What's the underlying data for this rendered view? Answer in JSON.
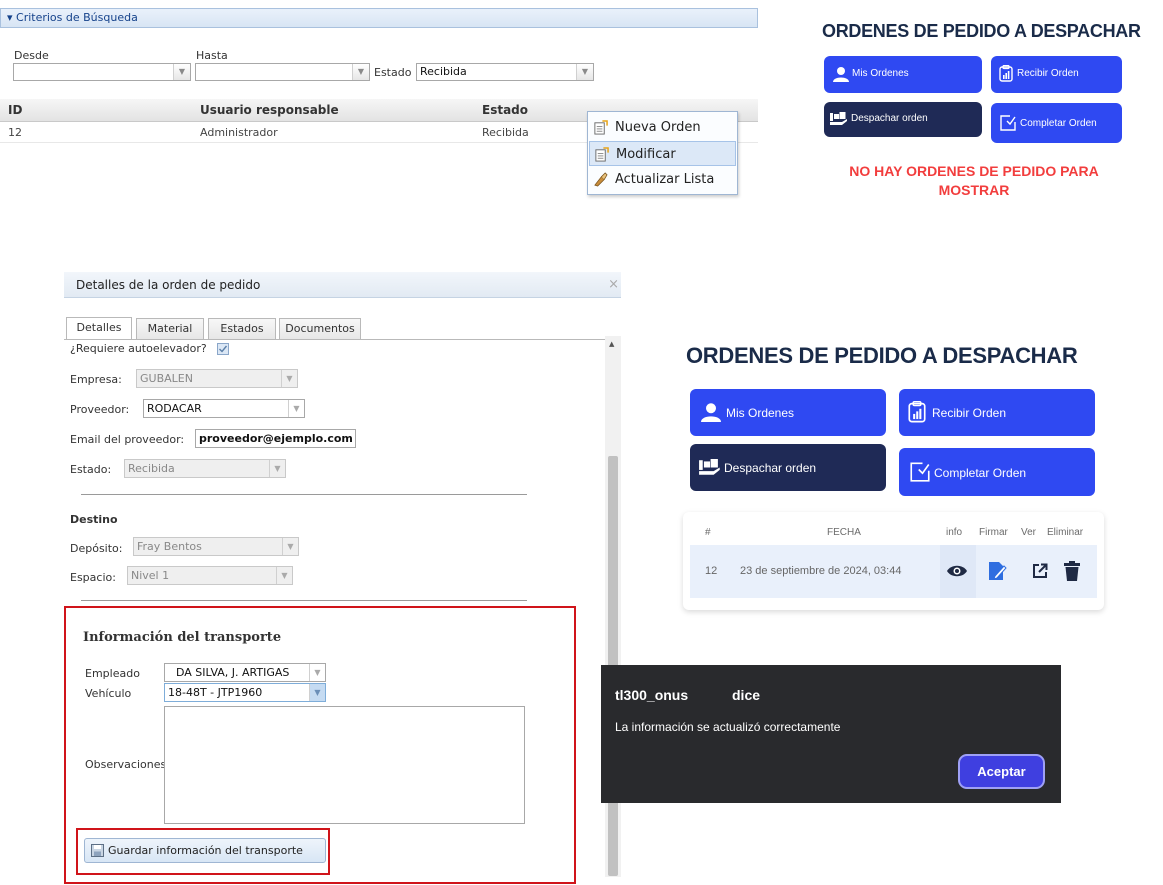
{
  "search_panel": {
    "header": "▾ Criterios de Búsqueda",
    "desde_label": "Desde",
    "hasta_label": "Hasta",
    "estado_label": "Estado",
    "estado_value": "Recibida",
    "columns": [
      "ID",
      "Usuario responsable",
      "Estado"
    ],
    "rows": [
      {
        "id": "12",
        "usuario": "Administrador",
        "estado": "Recibida"
      }
    ],
    "context_menu": [
      {
        "label": "Nueva Orden",
        "icon": "new-order-icon"
      },
      {
        "label": "Modificar",
        "icon": "edit-order-icon"
      },
      {
        "label": "Actualizar Lista",
        "icon": "refresh-icon"
      }
    ]
  },
  "dispatch_small": {
    "title": "ORDENES DE PEDIDO A DESPACHAR",
    "buttons": {
      "mis_ordenes": "Mis Ordenes",
      "recibir_orden": "Recibir Orden",
      "despachar_orden": "Despachar orden",
      "completar_orden": "Completar Orden"
    },
    "empty_message": "NO HAY ORDENES DE PEDIDO PARA MOSTRAR"
  },
  "details_window": {
    "title": "Detalles de la orden de pedido",
    "close": "×",
    "tabs": [
      "Detalles",
      "Material",
      "Estados",
      "Documentos"
    ],
    "requiere_autoelevador_label": "¿Requiere autoelevador?",
    "empresa_label": "Empresa:",
    "empresa_value": "GUBALEN",
    "proveedor_label": "Proveedor:",
    "proveedor_value": "RODACAR",
    "email_label": "Email del proveedor:",
    "email_value": "proveedor@ejemplo.com",
    "estado_label": "Estado:",
    "estado_value": "Recibida",
    "destino_title": "Destino",
    "deposito_label": "Depósito:",
    "deposito_value": "Fray Bentos",
    "espacio_label": "Espacio:",
    "espacio_value": "Nivel 1",
    "transporte_title": "Información del transporte",
    "empleado_label": "Empleado",
    "empleado_value": "DA SILVA, J. ARTIGAS",
    "vehiculo_label": "Vehículo",
    "vehiculo_value": "18-48T - JTP1960",
    "observaciones_label": "Observaciones",
    "guardar_button": "Guardar información del transporte"
  },
  "dispatch_large": {
    "title": "ORDENES DE PEDIDO A DESPACHAR",
    "buttons": {
      "mis_ordenes": "Mis Ordenes",
      "recibir_orden": "Recibir Orden",
      "despachar_orden": "Despachar orden",
      "completar_orden": "Completar Orden"
    },
    "table_columns": [
      "#",
      "FECHA",
      "info",
      "Firmar",
      "Ver",
      "Eliminar"
    ],
    "table_rows": [
      {
        "num": "12",
        "fecha": "23 de septiembre de 2024, 03:44"
      }
    ]
  },
  "alert": {
    "origin": "tl300_onus",
    "says": "dice",
    "message": "La información se actualizó correctamente",
    "accept": "Aceptar"
  },
  "colors": {
    "brand_blue": "#2f49f2",
    "brand_dark": "#1f2a56",
    "error_red": "#f23d3d",
    "highlight_red": "#d0141a"
  }
}
